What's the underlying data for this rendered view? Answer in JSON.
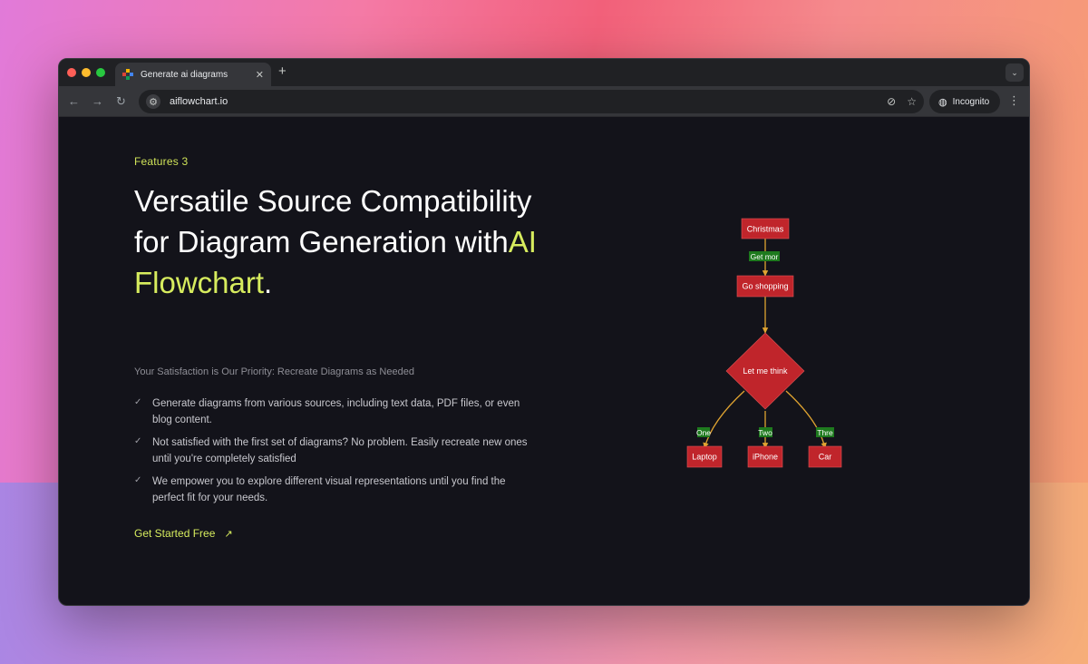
{
  "browser": {
    "tab_title": "Generate ai diagrams",
    "url": "aiflowchart.io",
    "incognito_label": "Incognito",
    "new_tab_symbol": "+",
    "tab_close_symbol": "✕"
  },
  "page": {
    "eyebrow": "Features 3",
    "headline_part1": "Versatile Source Compatibility for Diagram Generation with",
    "headline_accent": "AI Flowchart",
    "headline_end": ".",
    "subheading": "Your Satisfaction is Our Priority: Recreate Diagrams as Needed",
    "features": [
      "Generate diagrams from various sources, including text data, PDF files, or even blog content.",
      "Not satisfied with the first set of diagrams? No problem. Easily recreate new ones until you're completely satisfied",
      "We empower you to explore different visual representations until you find the perfect fit for your needs."
    ],
    "cta_label": "Get Started Free"
  },
  "flowchart": {
    "nodes": {
      "christmas": "Christmas",
      "shopping": "Go shopping",
      "think": "Let me think",
      "laptop": "Laptop",
      "iphone": "iPhone",
      "car": "Car"
    },
    "edges": {
      "get_money": "Get mor",
      "one": "One",
      "two": "Two",
      "three": "Thre"
    },
    "colors": {
      "node_fill": "#c0252b",
      "edge": "#e0a431",
      "edge_label_bg": "#1e7a1e"
    }
  },
  "colors": {
    "accent": "#d7ec5e",
    "page_bg": "#13131a"
  }
}
